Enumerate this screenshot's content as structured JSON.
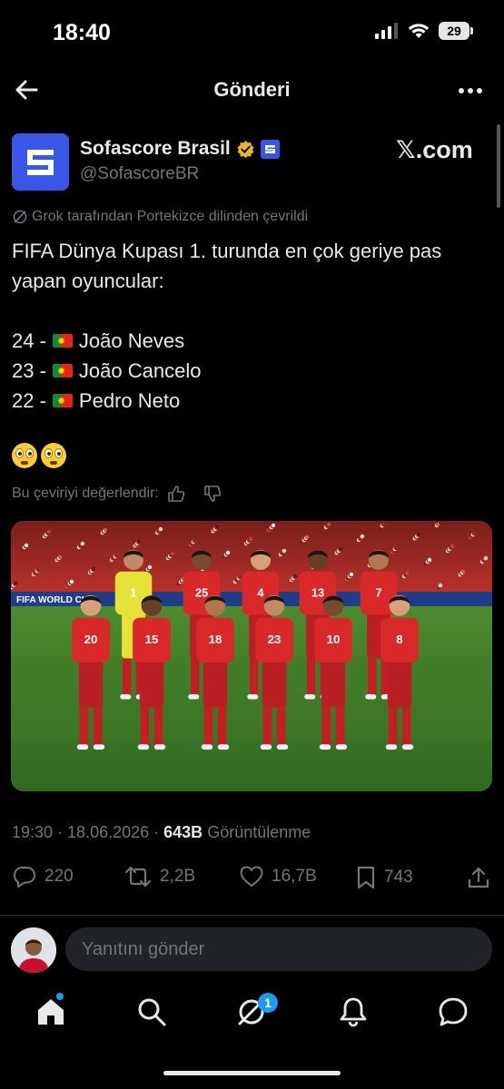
{
  "status_bar": {
    "time": "18:40",
    "battery": "29"
  },
  "nav": {
    "title": "Gönderi"
  },
  "author": {
    "name": "Sofascore Brasil",
    "handle": "@SofascoreBR",
    "source_label": "𝕏.com"
  },
  "grok_note": "Grok tarafından Portekizce dilinden çevrildi",
  "tweet": {
    "line1": "FIFA Dünya Kupası 1. turunda en çok geriye pas",
    "line2": "yapan oyuncular:",
    "players": [
      {
        "count": "24 -",
        "name": "João Neves"
      },
      {
        "count": "23 -",
        "name": "João Cancelo"
      },
      {
        "count": "22 -",
        "name": "Pedro Neto"
      }
    ],
    "emojis": "😳😳"
  },
  "rate_label": "Bu çeviriyi değerlendir:",
  "photo": {
    "banner": "FIFA WORLD CUP",
    "jersey_numbers": [
      "1",
      "25",
      "4",
      "13",
      "7",
      "20",
      "15",
      "18",
      "23",
      "10",
      "8"
    ]
  },
  "meta": {
    "time": "19:30",
    "sep": " · ",
    "date": "18.06.2026",
    "sep2": " · ",
    "views": "643B",
    "views_label": "Görüntülenme"
  },
  "actions": {
    "replies": "220",
    "reposts": "2,2B",
    "likes": "16,7B",
    "bookmarks": "743"
  },
  "reply": {
    "placeholder": "Yanıtını gönder"
  },
  "tabs": {
    "messages_badge": "1"
  },
  "colors": {
    "accent": "#1d9bf0",
    "avatar_blue": "#3a56e6",
    "verified_gold": "#e8b62a"
  }
}
